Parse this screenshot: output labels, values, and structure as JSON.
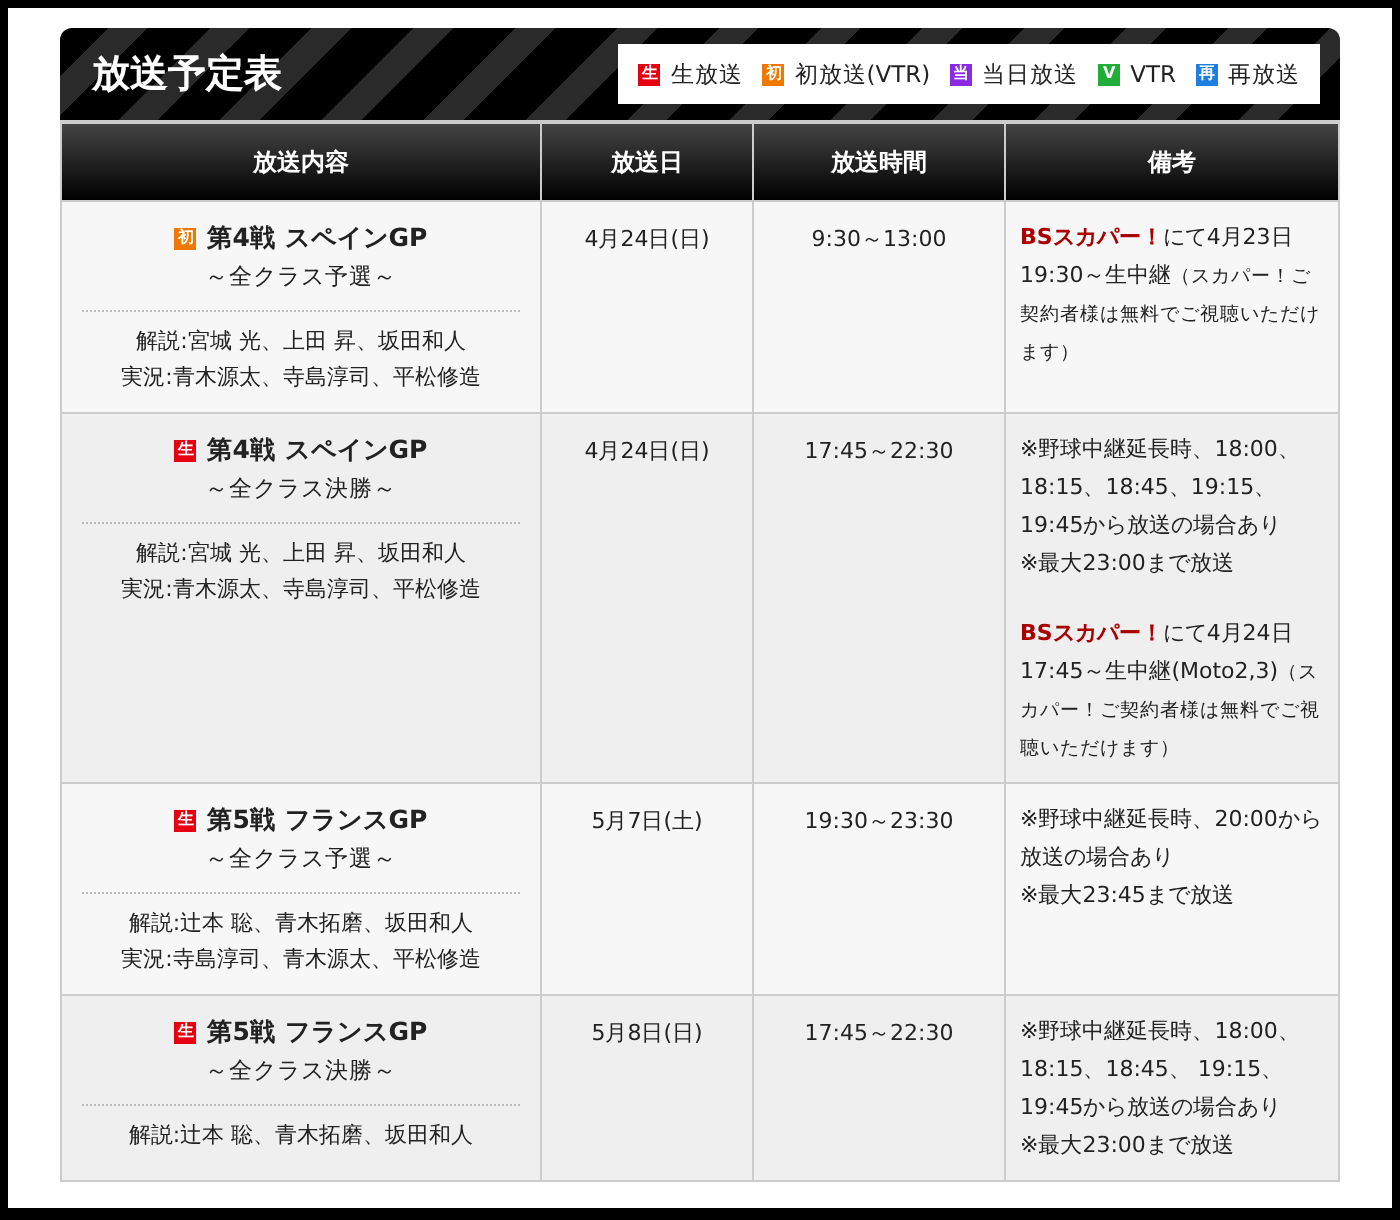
{
  "title": "放送予定表",
  "legend": [
    {
      "badge": "生",
      "label": "生放送",
      "color": "#e60012"
    },
    {
      "badge": "初",
      "label": "初放送(VTR)",
      "color": "#ee7800"
    },
    {
      "badge": "当",
      "label": "当日放送",
      "color": "#8a2be2"
    },
    {
      "badge": "V",
      "label": "VTR",
      "color": "#22ac38"
    },
    {
      "badge": "再",
      "label": "再放送",
      "color": "#1e7fe0"
    }
  ],
  "columns": [
    "放送内容",
    "放送日",
    "放送時間",
    "備考"
  ],
  "rows": [
    {
      "badge": {
        "text": "初",
        "color": "#ee7800"
      },
      "program": "第4戦 スペインGP",
      "subtitle": "～全クラス予選～",
      "credits": [
        "解説:宮城 光、上田 昇、坂田和人",
        "実況:青木源太、寺島淳司、平松修造"
      ],
      "date": "4月24日(日)",
      "time": "9:30～13:00",
      "notes": [
        [
          {
            "kind": "brand",
            "text": "BSスカパー！"
          },
          {
            "kind": "plain",
            "text": "にて4月23日 19:30～生中継"
          },
          {
            "kind": "small",
            "text": "（スカパー！ご契約者様は無料でご視聴いただけます）"
          }
        ]
      ]
    },
    {
      "badge": {
        "text": "生",
        "color": "#e60012"
      },
      "program": "第4戦 スペインGP",
      "subtitle": "～全クラス決勝～",
      "credits": [
        "解説:宮城 光、上田 昇、坂田和人",
        "実況:青木源太、寺島淳司、平松修造"
      ],
      "date": "4月24日(日)",
      "time": "17:45～22:30",
      "notes": [
        [
          {
            "kind": "plain",
            "text": "※野球中継延長時、18:00、18:15、18:45、19:15、19:45から放送の場合あり"
          }
        ],
        [
          {
            "kind": "plain",
            "text": "※最大23:00まで放送"
          }
        ],
        [
          {
            "kind": "brand",
            "text": "BSスカパー！"
          },
          {
            "kind": "plain",
            "text": "にて4月24日 17:45～生中継(Moto2,3)"
          },
          {
            "kind": "small",
            "text": "（スカパー！ご契約者様は無料でご視聴いただけます）"
          }
        ]
      ]
    },
    {
      "badge": {
        "text": "生",
        "color": "#e60012"
      },
      "program": "第5戦 フランスGP",
      "subtitle": "～全クラス予選～",
      "credits": [
        "解説:辻本 聡、青木拓磨、坂田和人",
        "実況:寺島淳司、青木源太、平松修造"
      ],
      "date": "5月7日(土)",
      "time": "19:30～23:30",
      "notes": [
        [
          {
            "kind": "plain",
            "text": "※野球中継延長時、20:00から放送の場合あり"
          }
        ],
        [
          {
            "kind": "plain",
            "text": "※最大23:45まで放送"
          }
        ]
      ]
    },
    {
      "badge": {
        "text": "生",
        "color": "#e60012"
      },
      "program": "第5戦 フランスGP",
      "subtitle": "～全クラス決勝～",
      "credits": [
        "解説:辻本 聡、青木拓磨、坂田和人"
      ],
      "date": "5月8日(日)",
      "time": "17:45～22:30",
      "notes": [
        [
          {
            "kind": "plain",
            "text": "※野球中継延長時、18:00、18:15、18:45、 19:15、19:45から放送の場合あり"
          }
        ],
        [
          {
            "kind": "plain",
            "text": "※最大23:00まで放送"
          }
        ]
      ]
    }
  ]
}
